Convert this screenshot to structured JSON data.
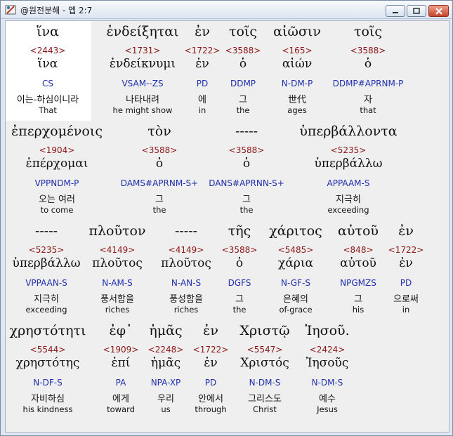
{
  "window": {
    "title": "@원전분해 - 엡 2:7"
  },
  "rows": [
    {
      "words": [
        {
          "greek": "ἵνα",
          "strong": "<2443>",
          "lemma": "ἵνα",
          "parse": "CS",
          "korean": "이는-하심이니라",
          "english": "That"
        },
        {
          "greek": "ἐνδείξηται",
          "strong": "<1731>",
          "lemma": "ἐνδείκνυμι",
          "parse": "VSAM--ZS",
          "korean": "나타내려",
          "english": "he might show"
        },
        {
          "greek": "ἐν",
          "strong": "<1722>",
          "lemma": "ἐν",
          "parse": "PD",
          "korean": "에",
          "english": "in"
        },
        {
          "greek": "τοῖς",
          "strong": "<3588>",
          "lemma": "ὁ",
          "parse": "DDMP",
          "korean": "그",
          "english": "the"
        },
        {
          "greek": "αἰῶσιν",
          "strong": "<165>",
          "lemma": "αἰών",
          "parse": "N-DM-P",
          "korean": "世代",
          "english": "ages"
        },
        {
          "greek": "τοῖς",
          "strong": "<3588>",
          "lemma": "ὁ",
          "parse": "DDMP#APRNM-P",
          "korean": "자",
          "english": "that"
        }
      ]
    },
    {
      "words": [
        {
          "greek": "ἐπερχομένοις",
          "strong": "<1904>",
          "lemma": "ἐπέρχομαι",
          "parse": "VPPNDM-P",
          "korean": "오는 여러",
          "english": "to come"
        },
        {
          "greek": "τὸν",
          "strong": "<3588>",
          "lemma": "ὁ",
          "parse": "DAMS#APRNM-S+",
          "korean": "그",
          "english": "the"
        },
        {
          "greek": "-----",
          "strong": "<3588>",
          "lemma": "ὁ",
          "parse": "DANS#APRNN-S+",
          "korean": "그",
          "english": "the"
        },
        {
          "greek": "ὑπερβάλλοντα",
          "strong": "<5235>",
          "lemma": "ὑπερβάλλω",
          "parse": "APPAAM-S",
          "korean": "지극히",
          "english": "exceeding"
        }
      ]
    },
    {
      "words": [
        {
          "greek": "-----",
          "strong": "<5235>",
          "lemma": "ὑπερβάλλω",
          "parse": "VPPAAN-S",
          "korean": "지극히",
          "english": "exceeding"
        },
        {
          "greek": "πλοῦτον",
          "strong": "<4149>",
          "lemma": "πλοῦτος",
          "parse": "N-AM-S",
          "korean": "풍서함을",
          "english": "riches"
        },
        {
          "greek": "-----",
          "strong": "<4149>",
          "lemma": "πλοῦτος",
          "parse": "N-AN-S",
          "korean": "풍성함을",
          "english": "riches"
        },
        {
          "greek": "τῆς",
          "strong": "<3588>",
          "lemma": "ὁ",
          "parse": "DGFS",
          "korean": "그",
          "english": "the"
        },
        {
          "greek": "χάριτος",
          "strong": "<5485>",
          "lemma": "χάρια",
          "parse": "N-GF-S",
          "korean": "은혜의",
          "english": "of-grace"
        },
        {
          "greek": "αὐτοῦ",
          "strong": "<848>",
          "lemma": "αὐτοῦ",
          "parse": "NPGMZS",
          "korean": "그",
          "english": "his"
        },
        {
          "greek": "ἐν",
          "strong": "<1722>",
          "lemma": "ἐν",
          "parse": "PD",
          "korean": "으로써",
          "english": "in"
        }
      ]
    },
    {
      "words": [
        {
          "greek": "χρηστότητι",
          "strong": "<5544>",
          "lemma": "χρηστότης",
          "parse": "N-DF-S",
          "korean": "자비하심",
          "english": "his kindness"
        },
        {
          "greek": "ἐφ᾽",
          "strong": "<1909>",
          "lemma": "ἐπί",
          "parse": "PA",
          "korean": "에게",
          "english": "toward"
        },
        {
          "greek": "ἡμᾶς",
          "strong": "<2248>",
          "lemma": "ἡμᾶς",
          "parse": "NPA-XP",
          "korean": "우리",
          "english": "us"
        },
        {
          "greek": "ἐν",
          "strong": "<1722>",
          "lemma": "ἐν",
          "parse": "PD",
          "korean": "안에서",
          "english": "through"
        },
        {
          "greek": "Χριστῷ",
          "strong": "<5547>",
          "lemma": "Χριστός",
          "parse": "N-DM-S",
          "korean": "그리스도",
          "english": "Christ"
        },
        {
          "greek": "Ἰησοῦ.",
          "strong": "<2424>",
          "lemma": "Ἰησοῦς",
          "parse": "N-DM-S",
          "korean": "예수",
          "english": "Jesus"
        }
      ]
    }
  ]
}
